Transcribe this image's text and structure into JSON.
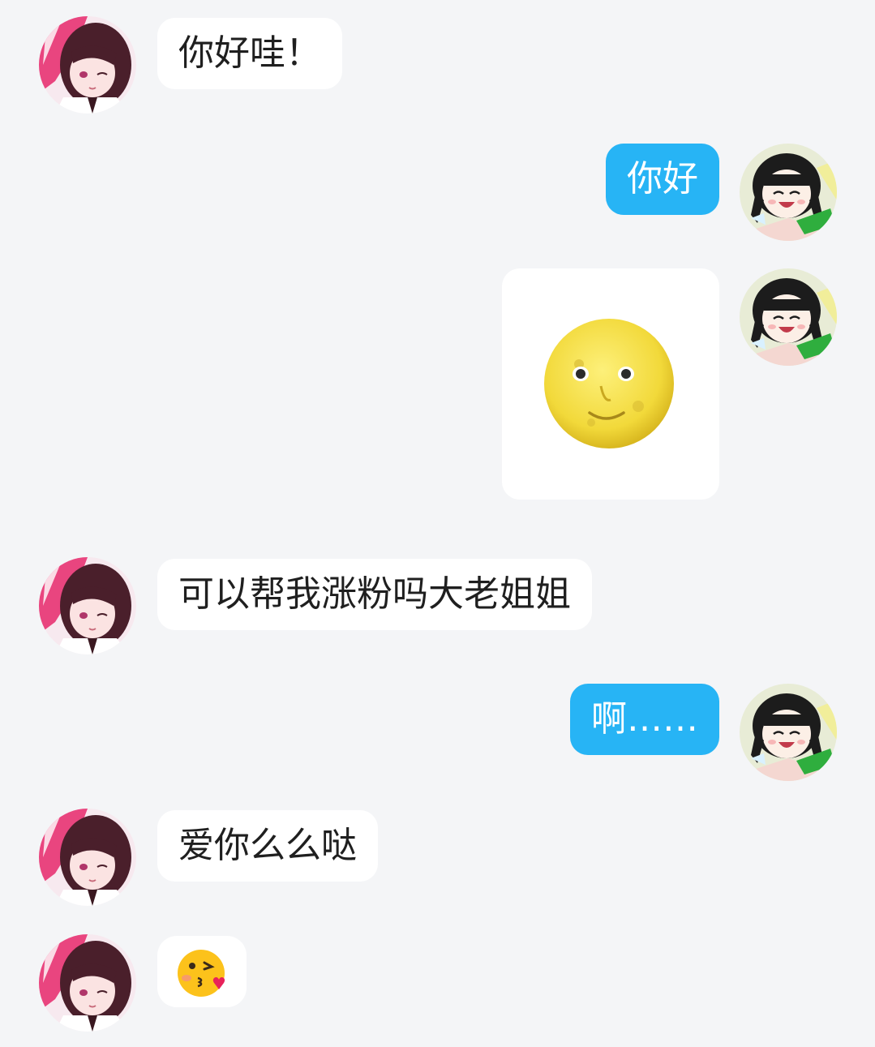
{
  "chat": {
    "messages": [
      {
        "id": "m1",
        "side": "incoming",
        "kind": "text",
        "text": "你好哇！"
      },
      {
        "id": "m2",
        "side": "outgoing",
        "kind": "text",
        "text": "你好"
      },
      {
        "id": "m3",
        "side": "outgoing",
        "kind": "sticker",
        "sticker": "full-moon-face"
      },
      {
        "id": "m4",
        "side": "incoming",
        "kind": "text",
        "text": "可以帮我涨粉吗大老姐姐"
      },
      {
        "id": "m5",
        "side": "outgoing",
        "kind": "text",
        "text": "啊……"
      },
      {
        "id": "m6",
        "side": "incoming",
        "kind": "text",
        "text": "爱你么么哒"
      },
      {
        "id": "m7",
        "side": "incoming",
        "kind": "emoji",
        "emoji": "face-blowing-a-kiss"
      }
    ]
  },
  "colors": {
    "background": "#f4f5f7",
    "incoming_bubble": "#ffffff",
    "outgoing_bubble": "#27b4f5",
    "incoming_text": "#1f1f1f",
    "outgoing_text": "#ffffff"
  },
  "avatars": {
    "incoming": "anime-girl-dark-hair-winking-avatar",
    "outgoing": "anime-girl-laughing-avatar"
  }
}
